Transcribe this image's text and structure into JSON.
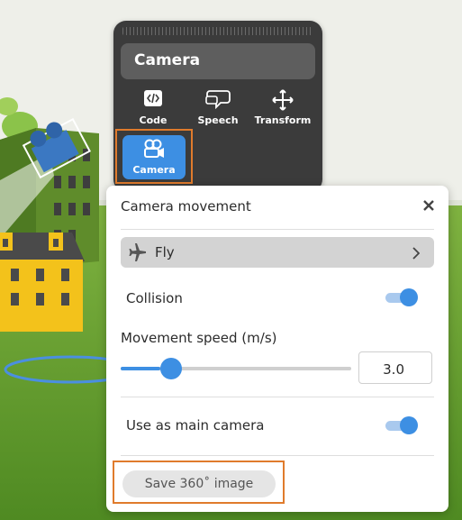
{
  "object_menu": {
    "title": "Camera",
    "tools": [
      {
        "label": "Code",
        "icon": "code-icon"
      },
      {
        "label": "Speech",
        "icon": "speech-bubble-icon"
      },
      {
        "label": "Transform",
        "icon": "move-arrows-icon"
      },
      {
        "label": "Camera",
        "icon": "camera-icon",
        "active": true
      }
    ]
  },
  "panel": {
    "title": "Camera movement",
    "close_icon": "close-icon",
    "movement_mode": {
      "label": "Fly",
      "icon": "airplane-icon",
      "chevron": "chevron-right-icon"
    },
    "collision": {
      "label": "Collision",
      "enabled": true
    },
    "movement_speed": {
      "label": "Movement speed (m/s)",
      "value": "3.0",
      "slider_fraction": 0.17
    },
    "main_camera": {
      "label": "Use as main camera",
      "enabled": true
    },
    "save_image_label": "Save 360˚ image"
  },
  "colors": {
    "accent": "#3d8fe3",
    "highlight": "#e07b2c",
    "toolbar": "#3b3b3b",
    "sky": "#eeefe9",
    "grass": "#6aa331"
  }
}
